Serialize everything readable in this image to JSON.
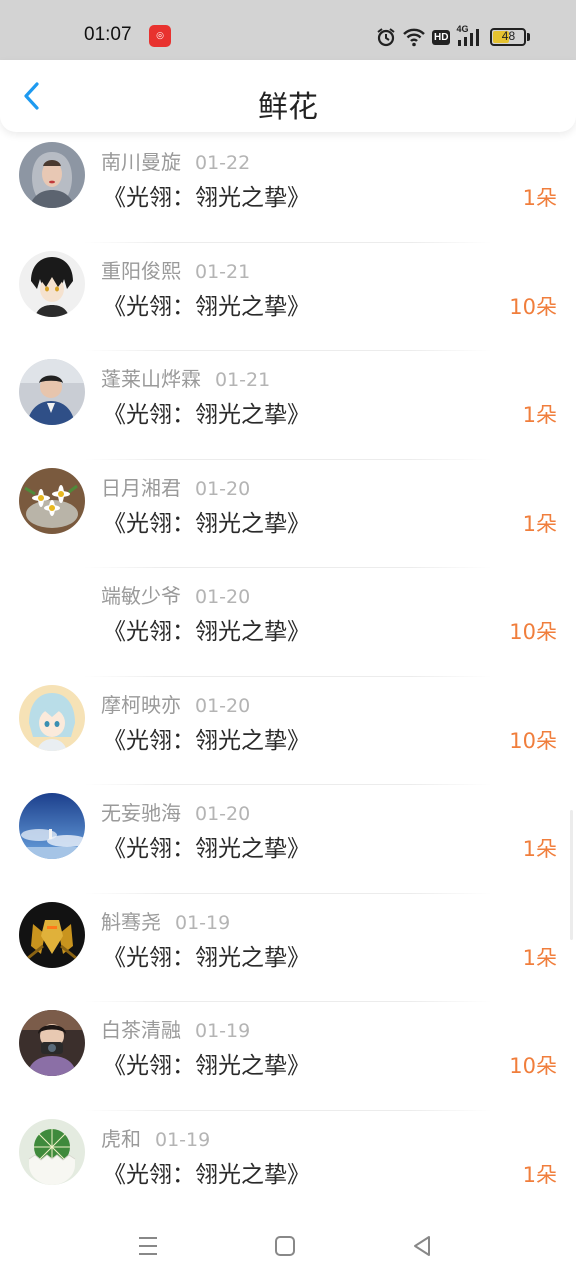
{
  "status_bar": {
    "time": "01:07",
    "app_icon": "red-app-notification-icon",
    "icons": [
      "alarm-icon",
      "wifi-icon",
      "hd-icon",
      "4g-signal-icon",
      "battery-icon"
    ],
    "hd_label": "HD",
    "network_label": "4G",
    "battery_level": "48",
    "battery_fraction": 0.48
  },
  "header": {
    "title": "鲜花",
    "back_icon": "chevron-left-icon"
  },
  "colors": {
    "accent_blue": "#1e9af0",
    "count_orange": "#f07e3c",
    "status_bar_bg": "#d3d3d3"
  },
  "records": [
    {
      "user": "南川曼旋",
      "date": "01-22",
      "book": "《光翎：翎光之挚》",
      "count": "1朵",
      "avatar": "woman-in-scarf-photo"
    },
    {
      "user": "重阳俊熙",
      "date": "01-21",
      "book": "《光翎：翎光之挚》",
      "count": "10朵",
      "avatar": "anime-boy-avatar"
    },
    {
      "user": "蓬莱山烨霖",
      "date": "01-21",
      "book": "《光翎：翎光之挚》",
      "count": "1朵",
      "avatar": "man-in-blue-jacket-photo"
    },
    {
      "user": "日月湘君",
      "date": "01-20",
      "book": "《光翎：翎光之挚》",
      "count": "1朵",
      "avatar": "daisy-flowers-photo"
    },
    {
      "user": "端敏少爷",
      "date": "01-20",
      "book": "《光翎：翎光之挚》",
      "count": "10朵",
      "avatar": "blank-avatar"
    },
    {
      "user": "摩柯映亦",
      "date": "01-20",
      "book": "《光翎：翎光之挚》",
      "count": "10朵",
      "avatar": "anime-girl-avatar"
    },
    {
      "user": "无妄驰海",
      "date": "01-20",
      "book": "《光翎：翎光之挚》",
      "count": "1朵",
      "avatar": "blue-sky-scene"
    },
    {
      "user": "斛骞尧",
      "date": "01-19",
      "book": "《光翎：翎光之挚》",
      "count": "1朵",
      "avatar": "golden-armor-figure"
    },
    {
      "user": "白茶清融",
      "date": "01-19",
      "book": "《光翎：翎光之挚》",
      "count": "10朵",
      "avatar": "girl-with-camera-photo"
    },
    {
      "user": "虎和",
      "date": "01-19",
      "book": "《光翎：翎光之挚》",
      "count": "1朵",
      "avatar": "cactus-in-eggshell-photo"
    }
  ],
  "nav_bar": {
    "menu_icon": "menu-icon",
    "home_icon": "home-square-icon",
    "back_icon": "back-triangle-icon"
  }
}
